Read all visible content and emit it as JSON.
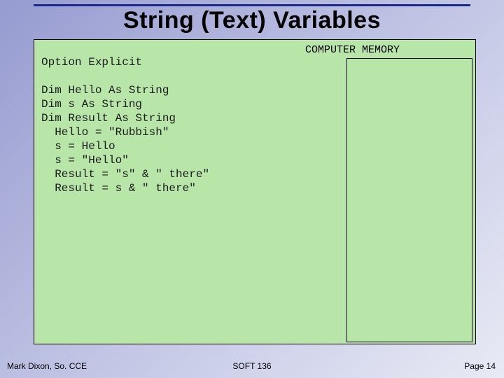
{
  "title": "String (Text) Variables",
  "memory_label": "COMPUTER MEMORY",
  "code": "Option Explicit\n\nDim Hello As String\nDim s As String\nDim Result As String\n  Hello = \"Rubbish\"\n  s = Hello\n  s = \"Hello\"\n  Result = \"s\" & \" there\"\n  Result = s & \" there\"",
  "footer": {
    "left": "Mark Dixon, So. CCE",
    "center": "SOFT 136",
    "right": "Page 14"
  },
  "chart_data": {
    "type": "table",
    "title": "COMPUTER MEMORY",
    "rows": []
  }
}
